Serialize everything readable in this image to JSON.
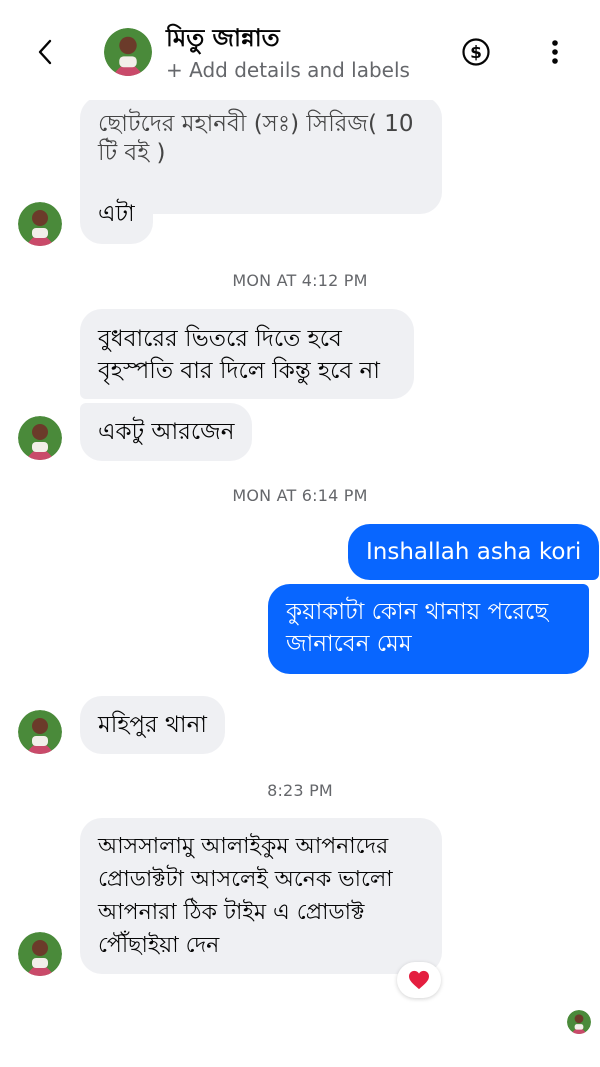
{
  "header": {
    "name": "মিতু জান্নাত",
    "subtitle": "+ Add details and labels",
    "back_icon": "chevron-left-icon",
    "payment_icon": "dollar-circle-icon",
    "more_icon": "more-vertical-icon"
  },
  "messages": [
    {
      "type": "in",
      "text": "ছোটদের মহানবী (সঃ) সিরিজ( 10\nটি বই  )"
    },
    {
      "type": "in",
      "text": "এটা"
    },
    {
      "type": "timestamp",
      "text": "MON AT 4:12 PM"
    },
    {
      "type": "in",
      "text": "বুধবারের ভিতরে দিতে হবে\nবৃহস্পতি বার দিলে কিন্তু হবে না"
    },
    {
      "type": "in",
      "text": "একটু আরজেন"
    },
    {
      "type": "timestamp",
      "text": "MON AT 6:14 PM"
    },
    {
      "type": "out",
      "text": "Inshallah asha kori"
    },
    {
      "type": "out",
      "text": "কুয়াকাটা কোন থানায় পরেছে\nজানাবেন মেম"
    },
    {
      "type": "in",
      "text": "মহিপুর থানা"
    },
    {
      "type": "timestamp",
      "text": "8:23 PM"
    },
    {
      "type": "in",
      "text": "আসসালামু আলাইকুম আপনাদের\nপ্রোডাক্টটা আসলেই অনেক ভালো\nআপনারা ঠিক টাইম এ প্রোডাক্ট\nপৌঁছাইয়া দেন"
    }
  ],
  "reaction": {
    "emoji": "❤️",
    "icon": "heart-icon",
    "color": "#e41e3f"
  },
  "colors": {
    "outgoing": "#0866ff",
    "incoming": "#eff0f3",
    "meta": "#65676b"
  }
}
